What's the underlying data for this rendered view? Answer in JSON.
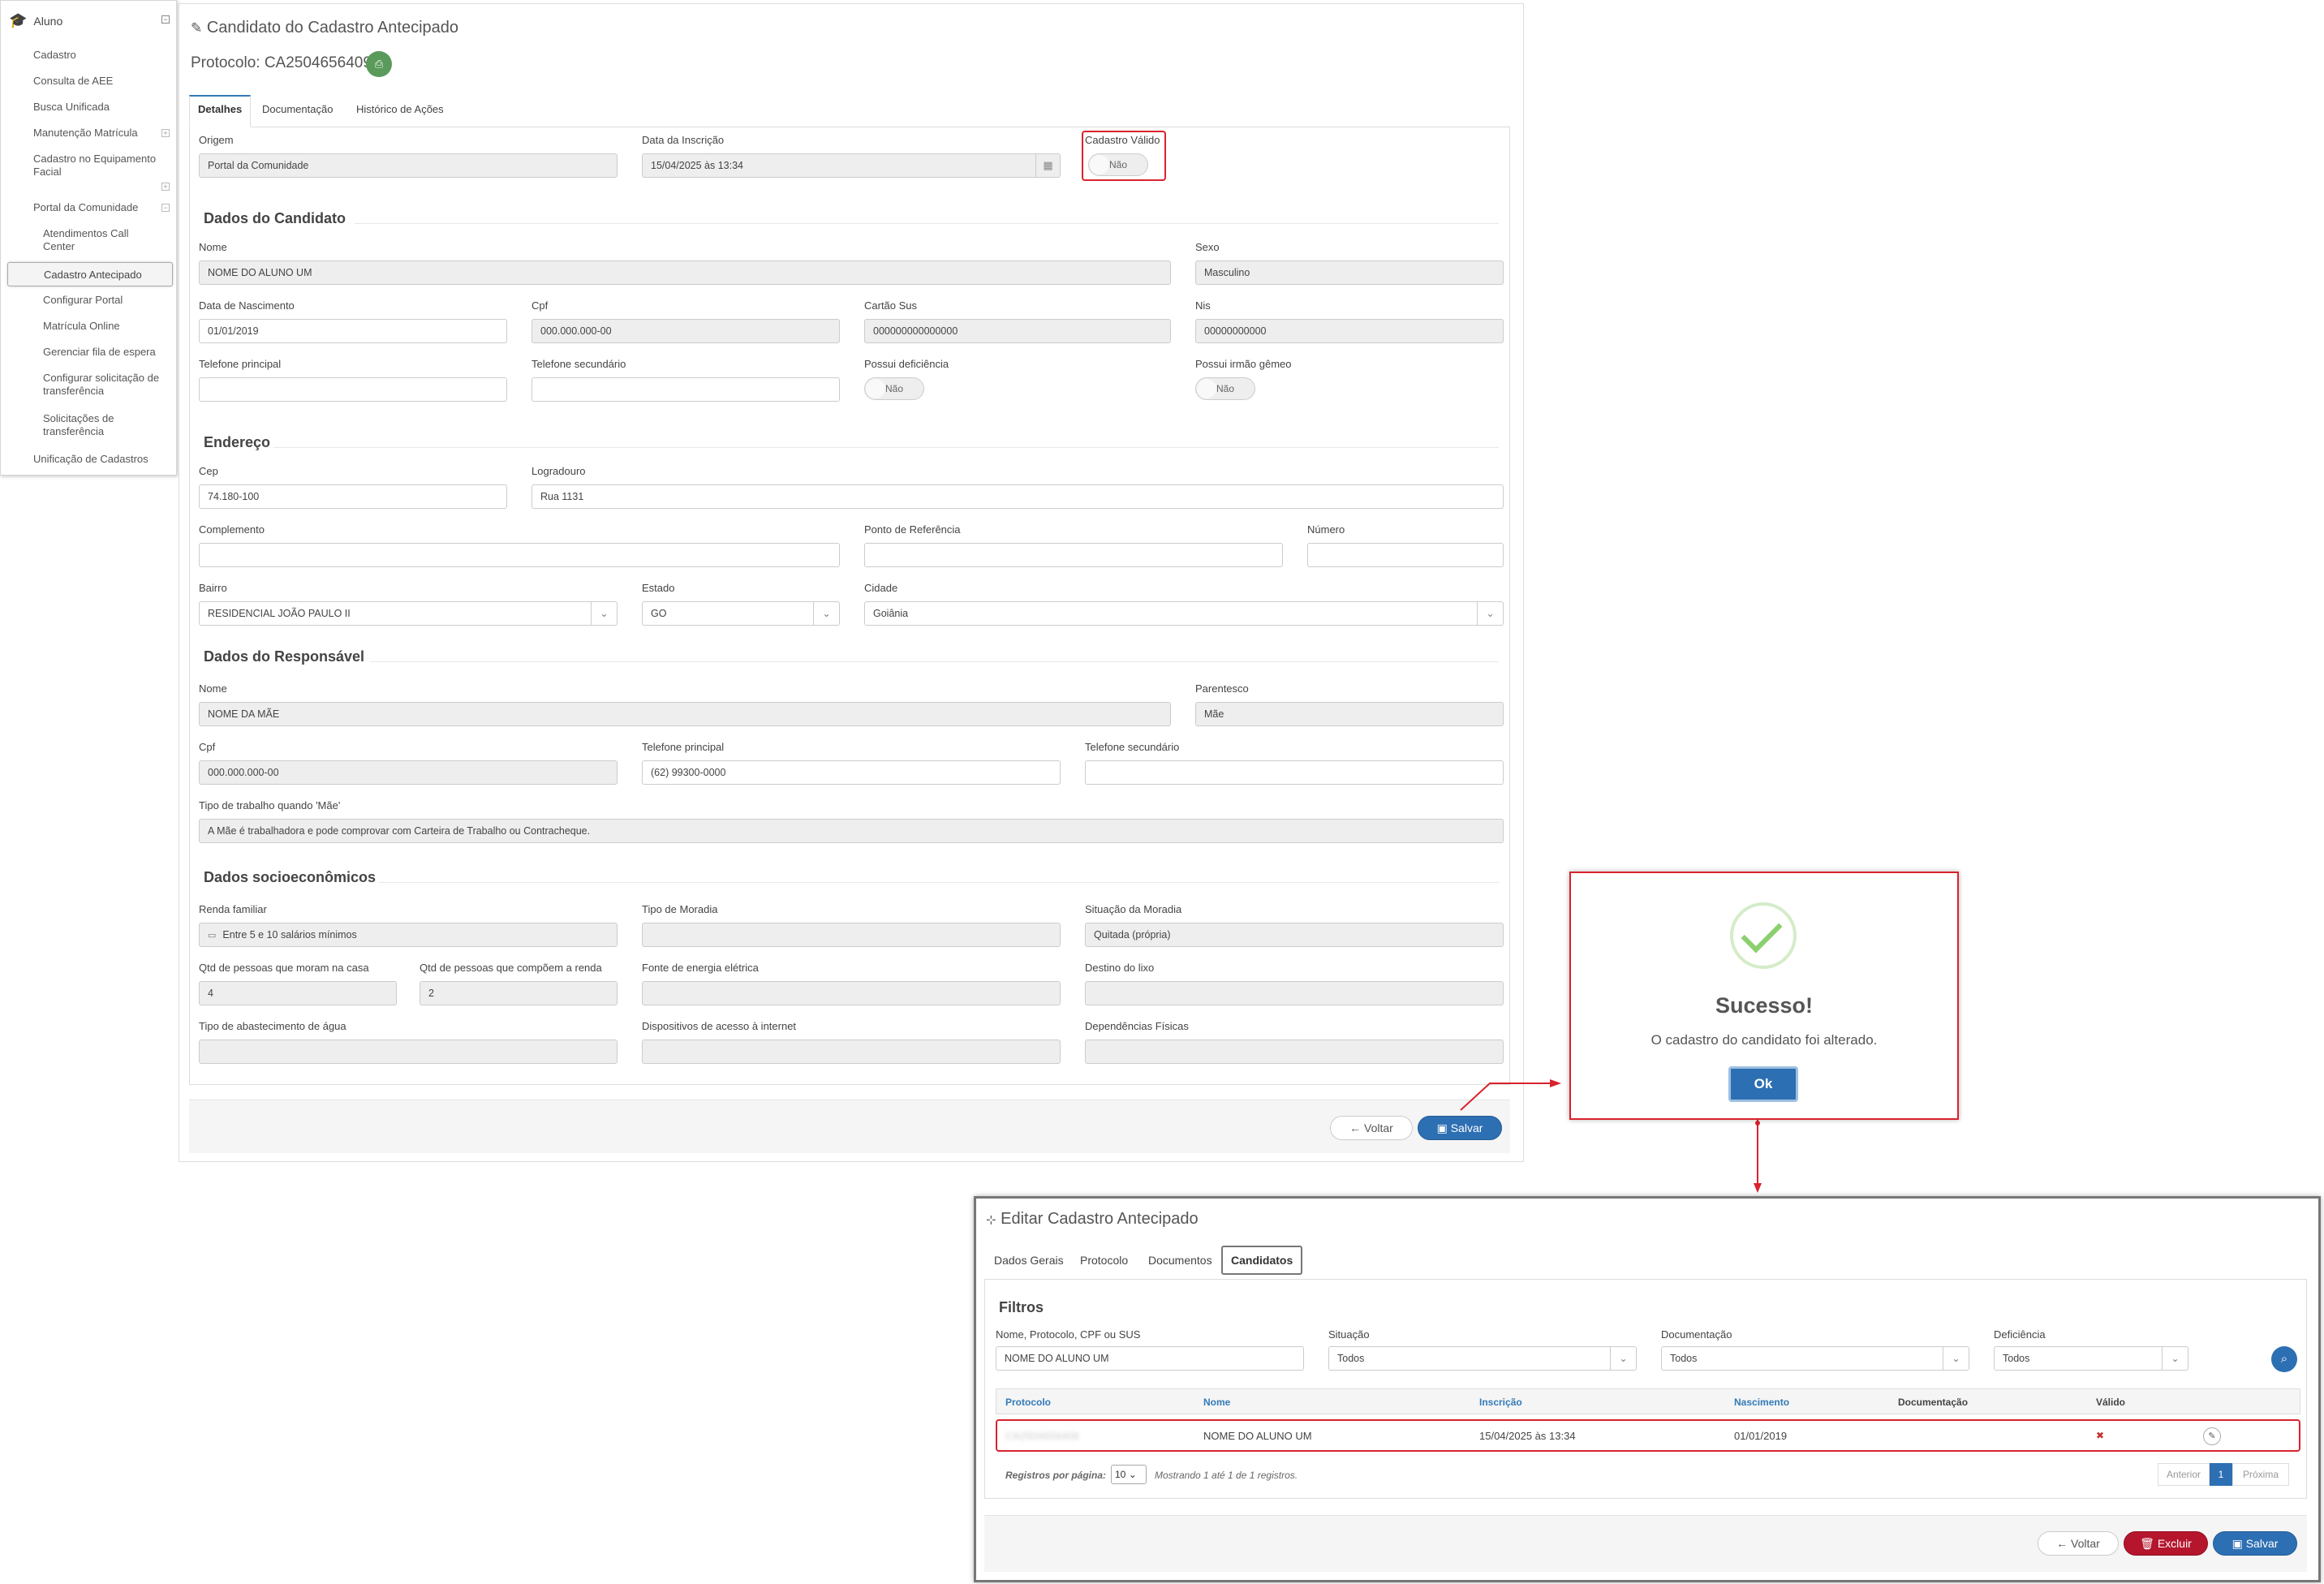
{
  "sidebar": {
    "module": "Aluno",
    "items": [
      {
        "label": "Cadastro"
      },
      {
        "label": "Consulta de AEE"
      },
      {
        "label": "Busca Unificada"
      },
      {
        "label": "Manutenção Matrícula"
      },
      {
        "label": "Cadastro no Equipamento Facial"
      },
      {
        "label": "Portal da Comunidade"
      }
    ],
    "subitems": [
      {
        "label": "Atendimentos Call Center"
      },
      {
        "label": "Cadastro Antecipado"
      },
      {
        "label": "Configurar Portal"
      },
      {
        "label": "Matrícula Online"
      },
      {
        "label": "Gerenciar fila de espera"
      },
      {
        "label": "Configurar solicitação de transferência"
      },
      {
        "label": "Solicitações de transferência"
      }
    ],
    "last_item": "Unificação de Cadastros",
    "toggle_minus": "⊟",
    "toggle_plus": "⊞"
  },
  "form": {
    "title": "Candidato do Cadastro Antecipado",
    "protocol": "Protocolo: CA2504656409",
    "tabs": [
      "Detalhes",
      "Documentação",
      "Histórico de Ações"
    ],
    "origem_label": "Origem",
    "origem": "Portal da Comunidade",
    "data_inscricao_label": "Data da Inscrição",
    "data_inscricao": "15/04/2025 às 13:34",
    "cadastro_valido_label": "Cadastro Válido",
    "cadastro_valido": "Não",
    "candidato": {
      "section": "Dados do Candidato",
      "nome_label": "Nome",
      "nome": "NOME DO ALUNO UM",
      "sexo_label": "Sexo",
      "sexo": "Masculino",
      "nasc_label": "Data de Nascimento",
      "nasc": "01/01/2019",
      "cpf_label": "Cpf",
      "cpf": "000.000.000-00",
      "sus_label": "Cartão Sus",
      "sus": "000000000000000",
      "nis_label": "Nis",
      "nis": "00000000000",
      "tel1_label": "Telefone principal",
      "tel1": "",
      "tel2_label": "Telefone secundário",
      "tel2": "",
      "def_label": "Possui deficiência",
      "def": "Não",
      "gemeo_label": "Possui irmão gêmeo",
      "gemeo": "Não"
    },
    "endereco": {
      "section": "Endereço",
      "cep_label": "Cep",
      "cep": "74.180-100",
      "logradouro_label": "Logradouro",
      "logradouro": "Rua 1131",
      "complemento_label": "Complemento",
      "complemento": "",
      "referencia_label": "Ponto de Referência",
      "referencia": "",
      "numero_label": "Número",
      "numero": "",
      "bairro_label": "Bairro",
      "bairro": "RESIDENCIAL JOÃO PAULO II",
      "estado_label": "Estado",
      "estado": "GO",
      "cidade_label": "Cidade",
      "cidade": "Goiânia"
    },
    "responsavel": {
      "section": "Dados do Responsável",
      "nome_label": "Nome",
      "nome": "NOME DA MÃE",
      "parentesco_label": "Parentesco",
      "parentesco": "Mãe",
      "cpf_label": "Cpf",
      "cpf": "000.000.000-00",
      "tel1_label": "Telefone principal",
      "tel1": "(62) 99300-0000",
      "tel2_label": "Telefone secundário",
      "tel2": "",
      "trabalho_label": "Tipo de trabalho quando 'Mãe'",
      "trabalho": "A Mãe é trabalhadora e pode comprovar com Carteira de Trabalho ou Contracheque."
    },
    "socio": {
      "section": "Dados socioeconômicos",
      "renda_label": "Renda familiar",
      "renda": "Entre 5 e 10 salários mínimos",
      "moradia_label": "Tipo de Moradia",
      "moradia": "",
      "situacao_label": "Situação da Moradia",
      "situacao": "Quitada (própria)",
      "moram_label": "Qtd de pessoas que moram na casa",
      "moram": "4",
      "renda_qtd_label": "Qtd de pessoas que compõem a renda",
      "renda_qtd": "2",
      "energia_label": "Fonte de energia elétrica",
      "energia": "",
      "lixo_label": "Destino do lixo",
      "lixo": "",
      "agua_label": "Tipo de abastecimento de água",
      "agua": "",
      "internet_label": "Dispositivos de acesso à internet",
      "internet": "",
      "fisicas_label": "Dependências Físicas",
      "fisicas": ""
    },
    "btn_voltar": "Voltar",
    "btn_salvar": "Salvar"
  },
  "modal": {
    "title": "Sucesso!",
    "message": "O cadastro do candidato foi alterado.",
    "ok": "Ok"
  },
  "panel": {
    "title": "Editar Cadastro Antecipado",
    "tabs": [
      "Dados Gerais",
      "Protocolo",
      "Documentos",
      "Candidatos"
    ],
    "filtros": "Filtros",
    "busca_label": "Nome, Protocolo, CPF ou SUS",
    "busca": "NOME DO ALUNO UM",
    "situacao_label": "Situação",
    "situacao": "Todos",
    "documentacao_label": "Documentação",
    "documentacao": "Todos",
    "deficiencia_label": "Deficiência",
    "deficiencia": "Todos",
    "columns": [
      "Protocolo",
      "Nome",
      "Inscrição",
      "Nascimento",
      "Documentação",
      "Válido"
    ],
    "row": {
      "protocolo": "CA2504656409",
      "nome": "NOME DO ALUNO UM",
      "inscricao": "15/04/2025 às 13:34",
      "nascimento": "01/01/2019",
      "documentacao": "",
      "valido": "✖"
    },
    "registros_label": "Registros por página:",
    "page_size": "10",
    "mostrando": "Mostrando 1 até 1 de 1 registros.",
    "anterior": "Anterior",
    "page": "1",
    "proxima": "Próxima",
    "btn_voltar": "Voltar",
    "btn_excluir": "Excluir",
    "btn_salvar": "Salvar"
  },
  "colors": {
    "accent": "#2d6fb3",
    "danger": "#b5162d",
    "highlight": "#d9232d",
    "success": "#8ccf6f"
  }
}
